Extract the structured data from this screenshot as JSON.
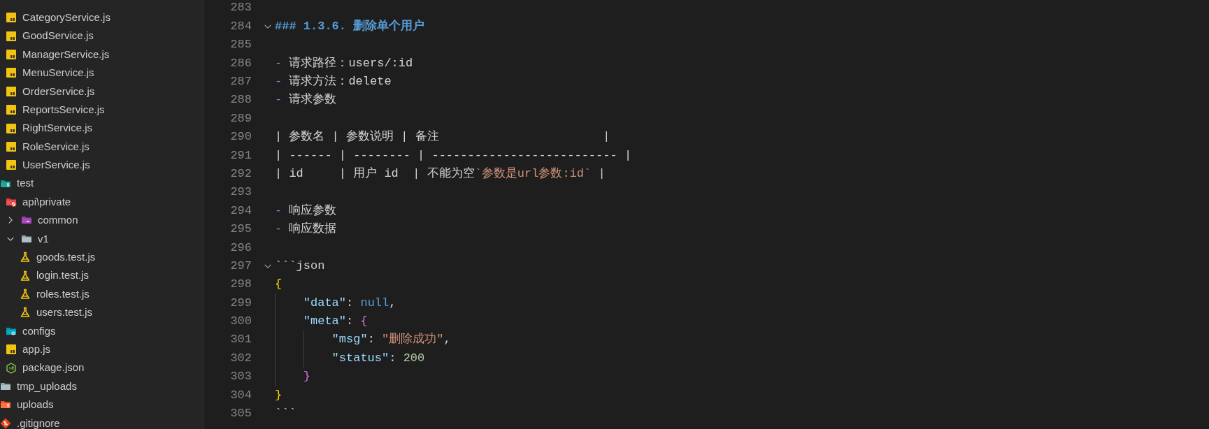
{
  "explorer": {
    "tree": [
      {
        "children": [
          {
            "kind": "js",
            "label": "CategoryService.js"
          },
          {
            "kind": "js",
            "label": "GoodService.js"
          },
          {
            "kind": "js",
            "label": "ManagerService.js"
          },
          {
            "kind": "js",
            "label": "MenuService.js"
          },
          {
            "kind": "js",
            "label": "OrderService.js"
          },
          {
            "kind": "js",
            "label": "ReportsService.js"
          },
          {
            "kind": "js",
            "label": "RightService.js"
          },
          {
            "kind": "js",
            "label": "RoleService.js"
          },
          {
            "kind": "js",
            "label": "UserService.js"
          }
        ]
      },
      {
        "kind": "folder-test",
        "label": "test"
      },
      {
        "children": [
          {
            "kind": "folder-api",
            "label": "api\\private",
            "children": [
              {
                "kind": "folder-common",
                "label": "common",
                "expanded": false
              },
              {
                "kind": "folder",
                "label": "v1",
                "expanded": true,
                "children": [
                  {
                    "kind": "test",
                    "label": "goods.test.js"
                  },
                  {
                    "kind": "test",
                    "label": "login.test.js"
                  },
                  {
                    "kind": "test",
                    "label": "roles.test.js"
                  },
                  {
                    "kind": "test",
                    "label": "users.test.js"
                  }
                ]
              }
            ]
          },
          {
            "kind": "folder-config",
            "label": "configs"
          },
          {
            "kind": "js",
            "label": "app.js"
          },
          {
            "kind": "node",
            "label": "package.json"
          }
        ]
      },
      {
        "kind": "folder",
        "label": "tmp_uploads"
      },
      {
        "kind": "folder-upload",
        "label": "uploads"
      },
      {
        "kind": "git",
        "label": ".gitignore"
      }
    ]
  },
  "editor": {
    "lines": [
      {
        "number": "283"
      },
      {
        "number": "284",
        "foldable": true,
        "segments": [
          {
            "kind": "heading",
            "text": "### 1.3.6. 删除单个用户"
          }
        ]
      },
      {
        "number": "285"
      },
      {
        "number": "286",
        "segments": [
          {
            "kind": "bullet",
            "text": "-"
          },
          {
            "kind": "text",
            "text": " 请求路径：users/:id"
          }
        ]
      },
      {
        "number": "287",
        "segments": [
          {
            "kind": "bullet",
            "text": "-"
          },
          {
            "kind": "text",
            "text": " 请求方法：delete"
          }
        ]
      },
      {
        "number": "288",
        "segments": [
          {
            "kind": "bullet",
            "text": "-"
          },
          {
            "kind": "text",
            "text": " 请求参数"
          }
        ]
      },
      {
        "number": "289"
      },
      {
        "number": "290",
        "segments": [
          {
            "kind": "text",
            "text": "| 参数名 | 参数说明 | 备注                       |"
          }
        ]
      },
      {
        "number": "291",
        "segments": [
          {
            "kind": "text",
            "text": "| ------ | -------- | -------------------------- |"
          }
        ]
      },
      {
        "number": "292",
        "segments": [
          {
            "kind": "text",
            "text": "| id     | 用户 id  | 不能为空"
          },
          {
            "kind": "code",
            "text": "`参数是url参数:id`"
          },
          {
            "kind": "text",
            "text": " |"
          }
        ]
      },
      {
        "number": "293"
      },
      {
        "number": "294",
        "segments": [
          {
            "kind": "bullet",
            "text": "-"
          },
          {
            "kind": "text",
            "text": " 响应参数"
          }
        ]
      },
      {
        "number": "295",
        "segments": [
          {
            "kind": "bullet",
            "text": "-"
          },
          {
            "kind": "text",
            "text": " 响应数据"
          }
        ]
      },
      {
        "number": "296"
      },
      {
        "number": "297",
        "foldable": true,
        "segments": [
          {
            "kind": "fence",
            "text": "```"
          },
          {
            "kind": "text",
            "text": "json"
          }
        ]
      },
      {
        "number": "298",
        "segments": [
          {
            "kind": "brace1",
            "text": "{"
          }
        ]
      },
      {
        "number": "299",
        "segments": [
          {
            "kind": "key",
            "text": "    \"data\""
          },
          {
            "kind": "text",
            "text": ": "
          },
          {
            "kind": "null",
            "text": "null"
          },
          {
            "kind": "text",
            "text": ","
          }
        ]
      },
      {
        "number": "300",
        "segments": [
          {
            "kind": "key",
            "text": "    \"meta\""
          },
          {
            "kind": "text",
            "text": ": "
          },
          {
            "kind": "brace2",
            "text": "{"
          }
        ]
      },
      {
        "number": "301",
        "segments": [
          {
            "kind": "key",
            "text": "        \"msg\""
          },
          {
            "kind": "text",
            "text": ": "
          },
          {
            "kind": "string",
            "text": "\"删除成功\""
          },
          {
            "kind": "text",
            "text": ","
          }
        ]
      },
      {
        "number": "302",
        "segments": [
          {
            "kind": "key",
            "text": "        \"status\""
          },
          {
            "kind": "text",
            "text": ": "
          },
          {
            "kind": "number",
            "text": "200"
          }
        ]
      },
      {
        "number": "303",
        "segments": [
          {
            "kind": "brace2",
            "text": "    }"
          }
        ]
      },
      {
        "number": "304",
        "segments": [
          {
            "kind": "brace1",
            "text": "}"
          }
        ]
      },
      {
        "number": "305",
        "segments": [
          {
            "kind": "fence",
            "text": "```"
          }
        ]
      }
    ]
  }
}
